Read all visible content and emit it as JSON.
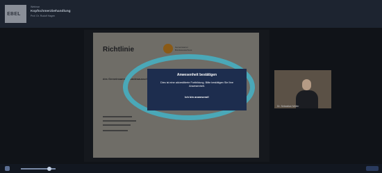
{
  "header": {
    "line1": "Webinar",
    "line2": "Kopfschmerzbehandlung",
    "line3": "Prof. Dr. Rudolf Hagen",
    "logo_text": "EBEL"
  },
  "slide": {
    "title": "Richtlinie",
    "logo_text": "Gemeinsamer Bundesausschuss",
    "subtitle": "des Gemeinsamen Bundesausschusses über die Früherkennung von Krankheiten bei Kindern"
  },
  "modal": {
    "title": "Anwesenheit bestätigen",
    "message": "Dies ist eine akkreditierte Fortbildung. Bitte bestätigen Sie Ihre Anwesenheit.",
    "button": "Ich bin anwesend!"
  },
  "speaker": {
    "label": "Dr. Sebastian Müller"
  },
  "player": {
    "progress": 0.82
  }
}
